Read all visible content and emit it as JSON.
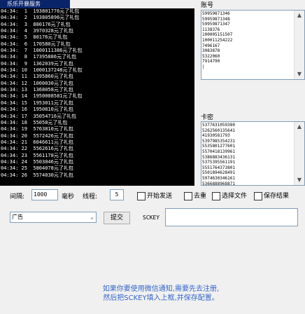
{
  "window": {
    "title": "乐乐开暴服务"
  },
  "log": {
    "lines": [
      "04:34:  1  193801776元了礼包",
      "04:34:  2  193805896元了礼包",
      "04:34:  3  880176元了礼包",
      "04:34:  4  3970328元了礼包",
      "04:34:  5  80176元了礼包",
      "04:34:  6  170580元了礼包",
      "04:34:  7  1000111386元了礼包",
      "04:34:  8  17395886元了礼包",
      "04:34:  9  1362039元了礼包",
      "04:34: 10  1000137248元了礼包",
      "04:34: 11  1395860元了礼包",
      "04:34: 12  1000030元了礼包",
      "04:34: 13  1368058元了礼包",
      "04:34: 14  1950008581元了礼包",
      "04:34: 15  1953011元了礼包",
      "04:34: 16  1950810元了礼包",
      "04:34: 17  35054716元了礼包",
      "04:34: 18  55058元了礼包",
      "04:34: 19  5763810元了礼包",
      "04:34: 20  5572426元了礼包",
      "04:34: 21  6046611元了礼包",
      "04:34: 22  5562616元了礼包",
      "04:34: 23  5561178元了礼包",
      "04:34: 24  5503046元了礼包",
      "04:34: 25  5804078元了礼包",
      "04:34: 26  5574030元了礼包"
    ]
  },
  "panel1": {
    "label": "账号",
    "items": [
      "59959871346",
      "59959871348",
      "59959871347",
      "1138376",
      "100005151507",
      "100011254222",
      "7496167",
      "3083878",
      "5322060",
      "7914790",
      "|"
    ]
  },
  "panel2": {
    "label": "卡密",
    "items": [
      "5377631059380",
      "5262560135641",
      "41930581793",
      "5397985354231",
      "5535801277601",
      "5570418139961",
      "5386883436131",
      "5375395561191",
      "5551764373801",
      "5501894628491",
      "5974630346161",
      "5366888968871"
    ]
  },
  "controls": {
    "interval_label": "间隔:",
    "interval_value": "1000",
    "interval_unit": "毫秒",
    "threads_label": "线程:",
    "threads_value": "5",
    "cb1_label": "开始发送",
    "cb2_label": "去重",
    "cb3_label": "选择文件",
    "cb4_label": "保存结果",
    "select_value": "广告",
    "submit_label": "提交",
    "key_label": "SCKEY",
    "key_value": ""
  },
  "notice": {
    "line1": "如果你要使用微信通知,需要先去注册,",
    "line2": "然后把SCKEY填入上框,并保存配置。"
  }
}
